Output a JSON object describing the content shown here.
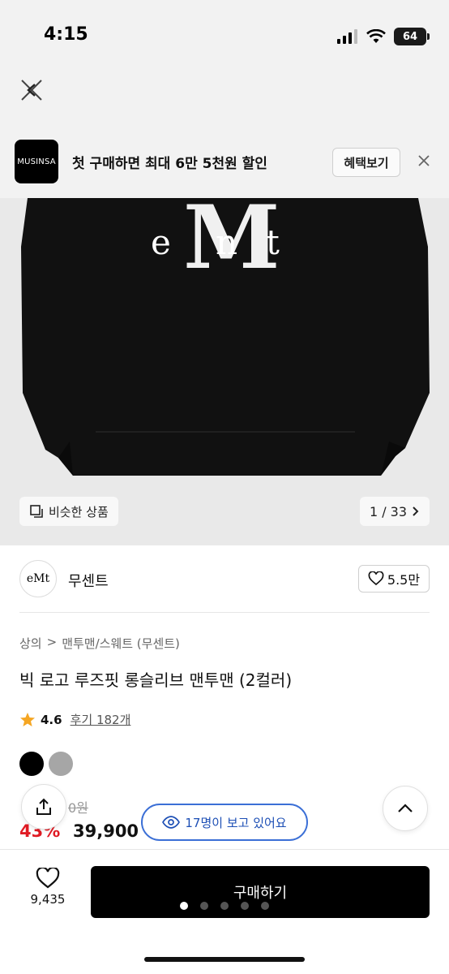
{
  "status": {
    "time": "4:15",
    "battery": "64"
  },
  "promo": {
    "logo_text": "MUSINSA",
    "text": "첫 구매하면 최대 6만 5천원 할인",
    "button_label": "혜택보기"
  },
  "product_image": {
    "logo_letters": [
      "e",
      "M",
      "n",
      "t"
    ],
    "similar_label": "비슷한 상품",
    "page_count": "1 / 33"
  },
  "brand": {
    "name": "무센트",
    "likes": "5.5만",
    "avatar_text": "eMt"
  },
  "breadcrumb": {
    "category": "상의",
    "separator": ">",
    "subcategory": "맨투맨/스웨트 (무센트)"
  },
  "product": {
    "title": "빅 로고 루즈핏 롱슬리브 맨투맨 (2컬러)",
    "rating": "4.6",
    "review_link": "후기 182개",
    "colors": [
      "#000000",
      "#a6a6a6"
    ],
    "original_price": "0원",
    "discount": "43%",
    "price": "39,900"
  },
  "viewers": {
    "text": "17명이 보고 있어요"
  },
  "bottom": {
    "wish_count": "9,435",
    "buy_label": "구매하기",
    "carousel_dots": 5,
    "active_dot": 0
  }
}
